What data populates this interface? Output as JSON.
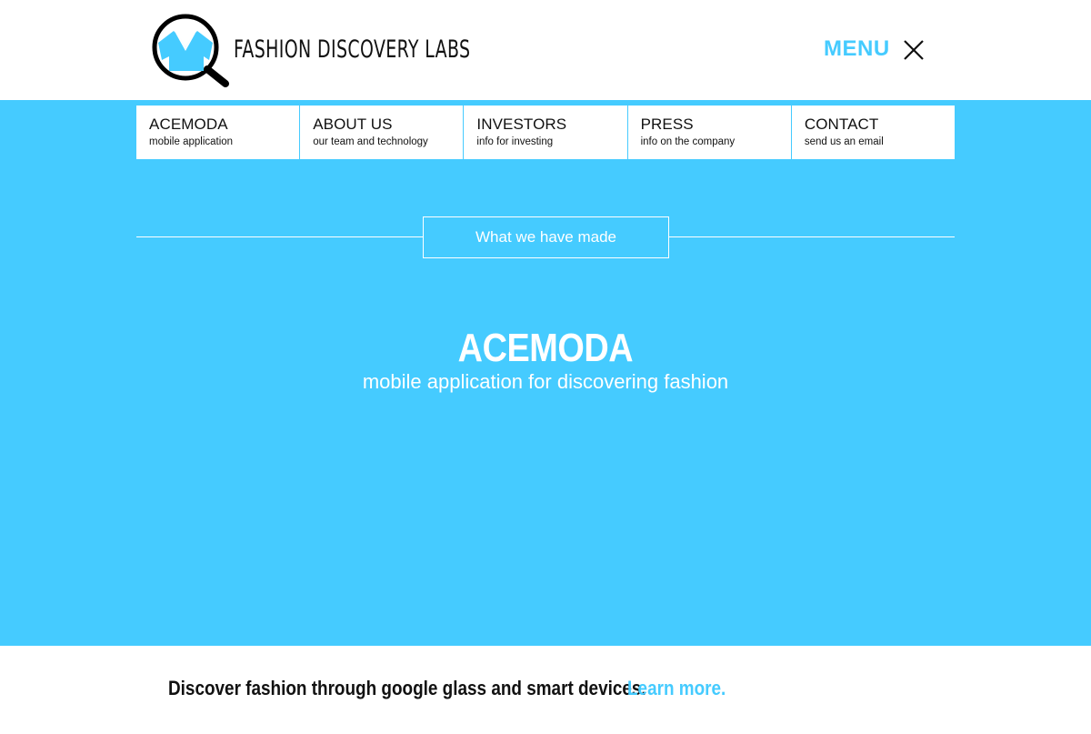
{
  "header": {
    "brand_name": "FASHION DISCOVERY LABS",
    "logo_icon": "magnifier-with-shirt-icon",
    "menu_label": "MENU",
    "menu_icon": "close-icon"
  },
  "nav": {
    "items": [
      {
        "title": "ACEMODA",
        "subtitle": "mobile application"
      },
      {
        "title": "ABOUT US",
        "subtitle": "our team and technology"
      },
      {
        "title": "INVESTORS",
        "subtitle": "info for investing"
      },
      {
        "title": "PRESS",
        "subtitle": "info on the company"
      },
      {
        "title": "CONTACT",
        "subtitle": "send us an email"
      }
    ]
  },
  "hero": {
    "section_label": "What we have made",
    "product_title": "ACEMODA",
    "product_subtitle": "mobile application for discovering fashion"
  },
  "footer": {
    "tagline": "Discover fashion through google glass and smart devices.",
    "learn_more": "Learn more."
  },
  "colors": {
    "accent": "#45cbff",
    "text": "#111111",
    "background": "#ffffff"
  }
}
